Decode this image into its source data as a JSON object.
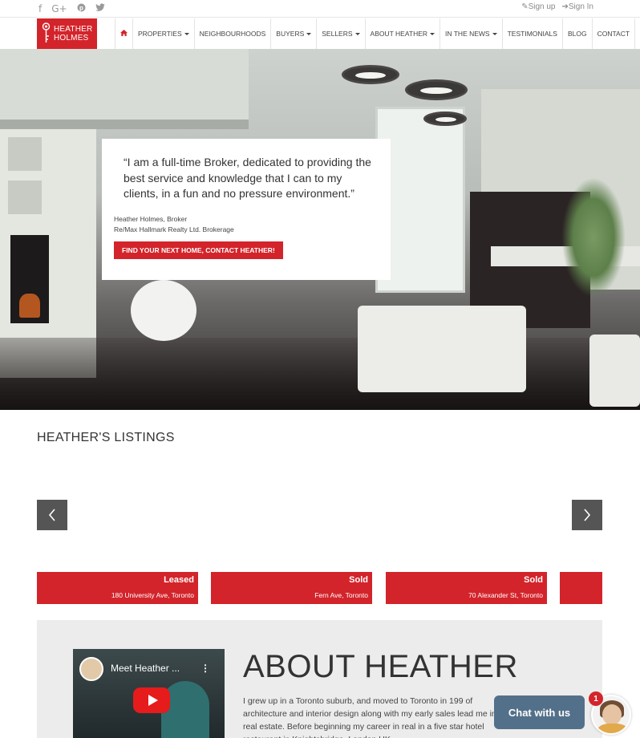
{
  "social": {
    "facebook": "f",
    "google_plus": "G+",
    "pinterest": "℗",
    "twitter": "🐦"
  },
  "auth": {
    "signup": "✎Sign up",
    "signin": "➔Sign In"
  },
  "logo": {
    "line1": "HEATHER",
    "line2": "HOLMES"
  },
  "nav": {
    "home_icon": "home-icon",
    "items": [
      {
        "label": "PROPERTIES",
        "dropdown": true
      },
      {
        "label": "NEIGHBOURHOODS",
        "dropdown": false
      },
      {
        "label": "BUYERS",
        "dropdown": true
      },
      {
        "label": "SELLERS",
        "dropdown": true
      },
      {
        "label": "ABOUT HEATHER",
        "dropdown": true
      },
      {
        "label": "IN THE NEWS",
        "dropdown": true
      },
      {
        "label": "TESTIMONIALS",
        "dropdown": false
      },
      {
        "label": "BLOG",
        "dropdown": false
      },
      {
        "label": "CONTACT",
        "dropdown": false
      }
    ]
  },
  "hero": {
    "quote": "“I am a full-time Broker, dedicated to providing the best service and knowledge that I can to my clients, in a fun and no pressure environment.”",
    "author_line1": "Heather Holmes, Broker",
    "author_line2": "Re/Max Hallmark Realty Ltd. Brokerage",
    "cta": "FIND YOUR NEXT HOME, CONTACT HEATHER!"
  },
  "listings": {
    "title": "HEATHER'S LISTINGS",
    "items": [
      {
        "status": "Leased",
        "address": "180 University Ave, Toronto"
      },
      {
        "status": "Sold",
        "address": "Fern Ave, Toronto"
      },
      {
        "status": "Sold",
        "address": "70 Alexander St, Toronto"
      },
      {
        "status": "",
        "address": ""
      }
    ]
  },
  "about": {
    "video_title": "Meet Heather ...",
    "video_menu": "⋮",
    "title": "ABOUT HEATHER",
    "text": "I grew up in a Toronto suburb, and moved to Toronto in 199 of architecture and interior design along with my early sales lead me into real estate. Before beginning my career in real in a five star hotel restaurant in Knightsbridge, London UK"
  },
  "chat": {
    "label": "Chat with us",
    "badge": "1"
  },
  "colors": {
    "brand_red": "#d3242b",
    "chat_blue": "#53708a",
    "carousel_gray": "#555555"
  }
}
